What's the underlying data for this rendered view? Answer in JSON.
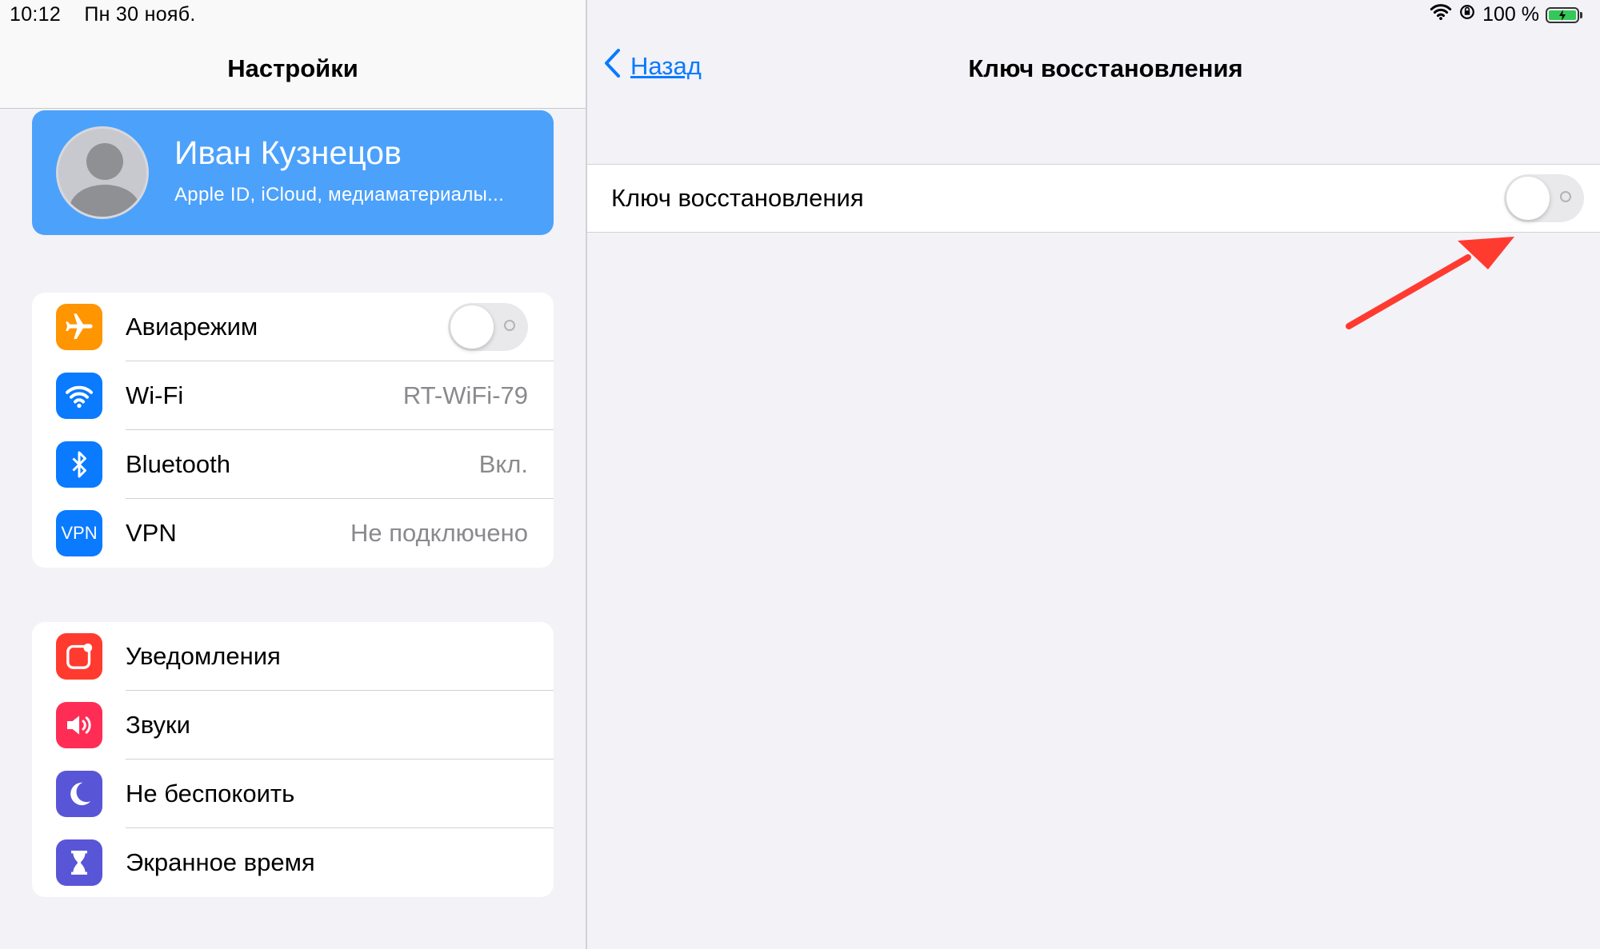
{
  "status_bar": {
    "time": "10:12",
    "date": "Пн 30 нояб.",
    "battery": "100 %"
  },
  "left": {
    "title": "Настройки",
    "profile": {
      "name": "Иван Кузнецов",
      "subtitle": "Apple ID, iCloud, медиаматериалы..."
    },
    "group1": [
      {
        "label": "Авиарежим",
        "icon": "airplane-icon",
        "color": "#ff9500",
        "toggle": false
      },
      {
        "label": "Wi-Fi",
        "icon": "wifi-icon",
        "color": "#0a7aff",
        "value": "RT-WiFi-79"
      },
      {
        "label": "Bluetooth",
        "icon": "bluetooth-icon",
        "color": "#0a7aff",
        "value": "Вкл."
      },
      {
        "label": "VPN",
        "icon": "vpn-icon",
        "icon_text": "VPN",
        "color": "#0a7aff",
        "value": "Не подключено"
      }
    ],
    "group2": [
      {
        "label": "Уведомления",
        "icon": "notifications-icon",
        "color": "#ff3b30"
      },
      {
        "label": "Звуки",
        "icon": "sounds-icon",
        "color": "#ff2d55"
      },
      {
        "label": "Не беспокоить",
        "icon": "moon-icon",
        "color": "#5856d6"
      },
      {
        "label": "Экранное время",
        "icon": "hourglass-icon",
        "color": "#5856d6"
      }
    ]
  },
  "right": {
    "back_label": "Назад",
    "title": "Ключ восстановления",
    "row_label": "Ключ восстановления",
    "toggle_on": false
  },
  "colors": {
    "accent": "#0a7aff",
    "profile_bg": "#4ca1fb",
    "annotation_arrow": "#ff3b30"
  }
}
